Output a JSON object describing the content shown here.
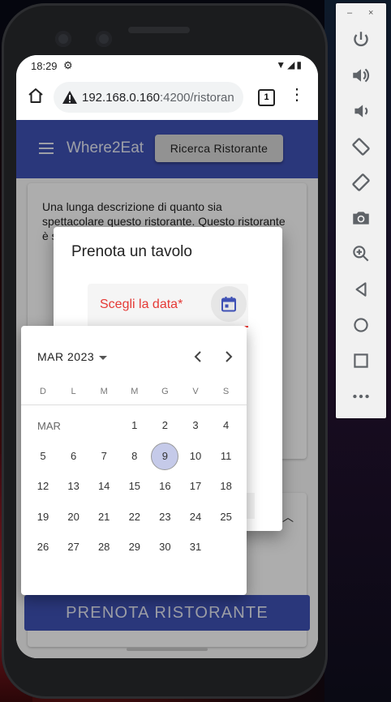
{
  "status_bar": {
    "time": "18:29"
  },
  "browser": {
    "url_host": "192.168.0.160",
    "url_path": ":4200/ristoran",
    "tab_count": "1"
  },
  "app": {
    "brand": "Where2Eat",
    "search_button": "Ricerca Ristorante",
    "description": "Una lunga descrizione di quanto sia spettacolare questo ristorante. Questo ristorante è sp",
    "book_button": "PRENOTA RISTORANTE",
    "accent_color": "#3f51b5"
  },
  "dialog": {
    "title": "Prenota un tavolo",
    "date_label": "Scegli la data*",
    "error_color": "#e53935"
  },
  "datepicker": {
    "period": "MAR 2023",
    "weekdays": [
      "D",
      "L",
      "M",
      "M",
      "G",
      "V",
      "S"
    ],
    "month_label": "MAR",
    "first_weekday_index": 3,
    "days_in_month": 31,
    "today": 9
  },
  "emulator": {
    "window_controls": [
      "–",
      "×"
    ],
    "icons": [
      "power-icon",
      "volume-up-icon",
      "volume-down-icon",
      "rotate-left-icon",
      "rotate-right-icon",
      "camera-icon",
      "zoom-icon",
      "back-icon",
      "home-icon",
      "overview-icon",
      "more-icon"
    ]
  }
}
